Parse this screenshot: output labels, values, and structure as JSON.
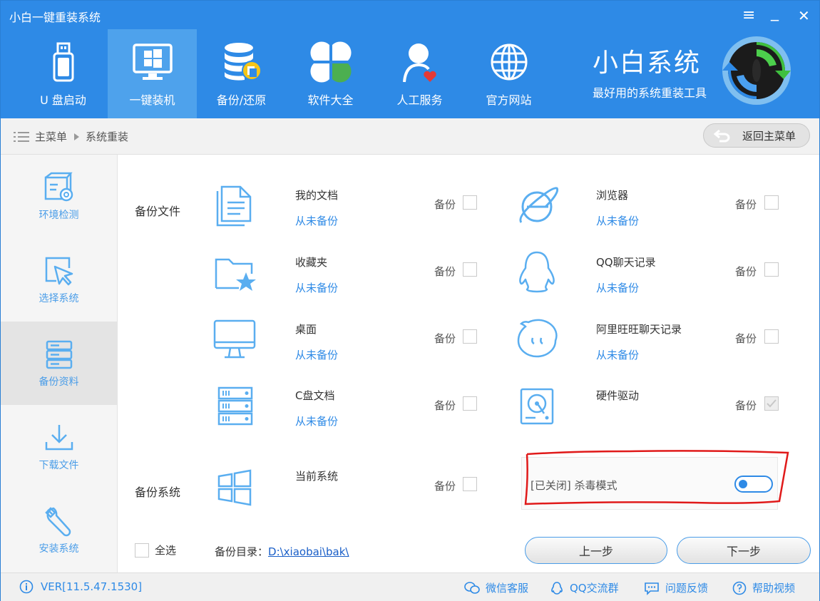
{
  "window": {
    "title": "小白一键重装系统",
    "menu_glyph": "≡",
    "min_glyph": "_",
    "close_glyph": "✕"
  },
  "nav": [
    {
      "label": "U 盘启动",
      "icon": "usb-drive-icon"
    },
    {
      "label": "一键装机",
      "icon": "monitor-windows-icon",
      "active": true
    },
    {
      "label": "备份/还原",
      "icon": "database-backup-icon"
    },
    {
      "label": "软件大全",
      "icon": "apps-clover-icon"
    },
    {
      "label": "人工服务",
      "icon": "support-person-icon"
    },
    {
      "label": "官方网站",
      "icon": "globe-icon"
    }
  ],
  "brand": {
    "title": "小白系统",
    "subtitle": "最好用的系统重装工具"
  },
  "breadcrumb": {
    "root": "主菜单",
    "current": "系统重装"
  },
  "back_button": "返回主菜单",
  "sidebar": [
    {
      "label": "环境检测",
      "icon": "environment-check-icon"
    },
    {
      "label": "选择系统",
      "icon": "select-cursor-icon"
    },
    {
      "label": "备份资料",
      "icon": "backup-server-icon",
      "active": true
    },
    {
      "label": "下载文件",
      "icon": "download-icon"
    },
    {
      "label": "安装系统",
      "icon": "wrench-icon"
    }
  ],
  "sections": {
    "files": "备份文件",
    "system": "备份系统"
  },
  "backup_label": "备份",
  "items": {
    "my_docs": {
      "name": "我的文档",
      "status": "从未备份",
      "icon": "documents-icon"
    },
    "browser": {
      "name": "浏览器",
      "status": "从未备份",
      "icon": "ie-browser-icon"
    },
    "favorites": {
      "name": "收藏夹",
      "status": "从未备份",
      "icon": "favorites-folder-icon"
    },
    "qq_chat": {
      "name": "QQ聊天记录",
      "status": "从未备份",
      "icon": "qq-penguin-icon"
    },
    "desktop": {
      "name": "桌面",
      "status": "从未备份",
      "icon": "desktop-monitor-icon"
    },
    "aliww": {
      "name": "阿里旺旺聊天记录",
      "status": "从未备份",
      "icon": "aliwangwang-icon"
    },
    "c_docs": {
      "name": "C盘文档",
      "status": "从未备份",
      "icon": "server-rack-icon"
    },
    "drivers": {
      "name": "硬件驱动",
      "icon": "hard-disk-icon",
      "checked": true
    },
    "current_system": {
      "name": "当前系统",
      "icon": "windows-logo-icon"
    }
  },
  "antivirus": {
    "state": "[已关闭]",
    "label": "杀毒模式",
    "on": false
  },
  "select_all": "全选",
  "backup_dir": {
    "label": "备份目录：",
    "path": "D:\\xiaobai\\bak\\"
  },
  "buttons": {
    "prev": "上一步",
    "next": "下一步"
  },
  "footer": {
    "version": "VER[11.5.47.1530]",
    "links": [
      "微信客服",
      "QQ交流群",
      "问题反馈",
      "帮助视频"
    ]
  },
  "colors": {
    "primary": "#2e8ae6",
    "nav_active": "#4ea2ec",
    "icon": "#5aaef0",
    "annotation": "#e01a1a"
  }
}
